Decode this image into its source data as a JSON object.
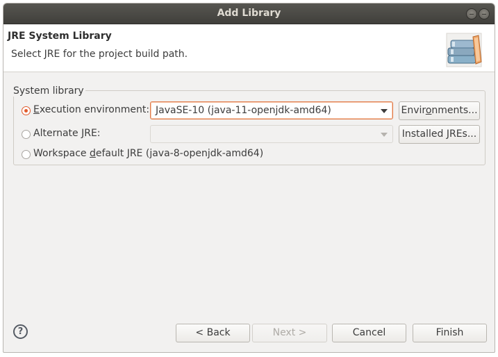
{
  "window": {
    "title": "Add Library"
  },
  "header": {
    "title": "JRE System Library",
    "message": "Select JRE for the project build path."
  },
  "group": {
    "label": "System library",
    "options": [
      {
        "label_pre": "",
        "label_mnemonic": "E",
        "label_post": "xecution environment:",
        "checked": true
      },
      {
        "label_pre": "Alternate ",
        "label_mnemonic": "J",
        "label_post": "RE:",
        "checked": false
      },
      {
        "label_pre": "Workspace ",
        "label_mnemonic": "d",
        "label_post": "efault JRE (java-8-openjdk-amd64)",
        "checked": false
      }
    ],
    "execution_env_value": "JavaSE-10 (java-11-openjdk-amd64)",
    "alternate_jre_value": "",
    "environments_button": {
      "pre": "Envir",
      "mnemonic": "o",
      "post": "nments..."
    },
    "installed_jres_button": {
      "pre": "Installed JREs..."
    }
  },
  "footer": {
    "help_icon": "?",
    "back": "< Back",
    "next": "Next >",
    "cancel": "Cancel",
    "finish": "Finish"
  },
  "colors": {
    "accent": "#e05a2b",
    "titlebar": "#403f3b",
    "dialog_bg": "#f2f1f0"
  },
  "icons": [
    "help-icon",
    "library-books-icon",
    "radio-icon",
    "dropdown-arrow-icon"
  ]
}
